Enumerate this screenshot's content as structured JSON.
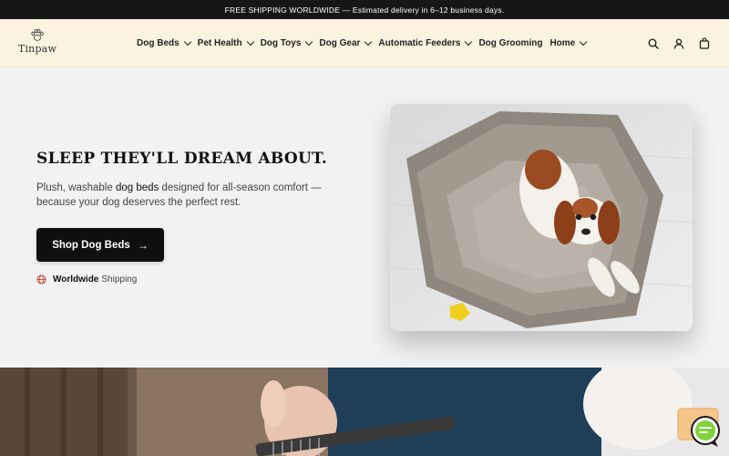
{
  "announcement": "FREE SHIPPING WORLDWIDE — Estimated delivery in 6–12 business days.",
  "brand": {
    "name": "Tinpaw"
  },
  "nav": [
    {
      "label": "Dog Beds",
      "dropdown": true
    },
    {
      "label": "Pet Health",
      "dropdown": true
    },
    {
      "label": "Dog Toys",
      "dropdown": true
    },
    {
      "label": "Dog Gear",
      "dropdown": true
    },
    {
      "label": "Automatic Feeders",
      "dropdown": true
    },
    {
      "label": "Dog Grooming",
      "dropdown": false
    },
    {
      "label": "Home",
      "dropdown": true
    }
  ],
  "header_icons": [
    "search-icon",
    "account-icon",
    "cart-icon"
  ],
  "hero": {
    "title": "SLEEP THEY'LL DREAM ABOUT.",
    "desc_before": "Plush, washable ",
    "desc_highlight": "dog beds",
    "desc_after": " designed for all-season comfort — because your dog deserves the perfect rest.",
    "cta_label": "Shop Dog Beds",
    "shipping_strong": "Worldwide",
    "shipping_text": "Shipping"
  },
  "colors": {
    "announce_bg": "#161616",
    "header_bg": "#fbf3df",
    "hero_bg": "#f2f2f2",
    "cta_bg": "#0f0f0f",
    "globe_accent": "#c0392b"
  }
}
